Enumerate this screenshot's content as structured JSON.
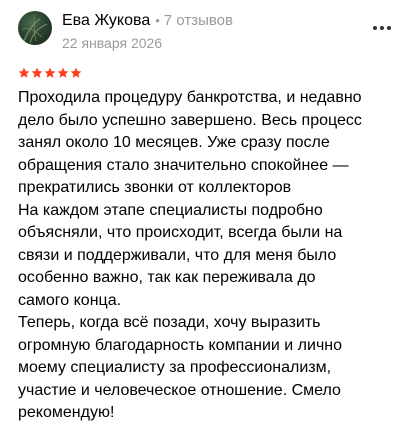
{
  "review": {
    "author": {
      "name": "Ева Жукова",
      "separator": "•",
      "reviews_count": "7 отзывов"
    },
    "date": "22 января 2026",
    "rating": {
      "value": 5,
      "max": 5,
      "star_color": "#fc3f1d"
    },
    "more_menu_icon": "more-dots-icon",
    "text_lines": [
      "Проходила процедуру банкротства, и недавно",
      "дело было успешно завершено. Весь процесс",
      "занял около 10 месяцев. Уже сразу после",
      "обращения стало значительно спокойнее —",
      "прекратились звонки от коллекторов",
      "На каждом этапе специалисты подробно",
      "объясняли, что происходит, всегда были на",
      "связи и поддерживали, что для меня было",
      "особенно важно, так как переживала до",
      "самого конца.",
      "Теперь, когда всё позади, хочу выразить",
      "огромную благодарность компании и лично",
      "моему специалисту за профессионализм,",
      "участие и человеческое отношение. Смело",
      "рекомендую!"
    ]
  }
}
